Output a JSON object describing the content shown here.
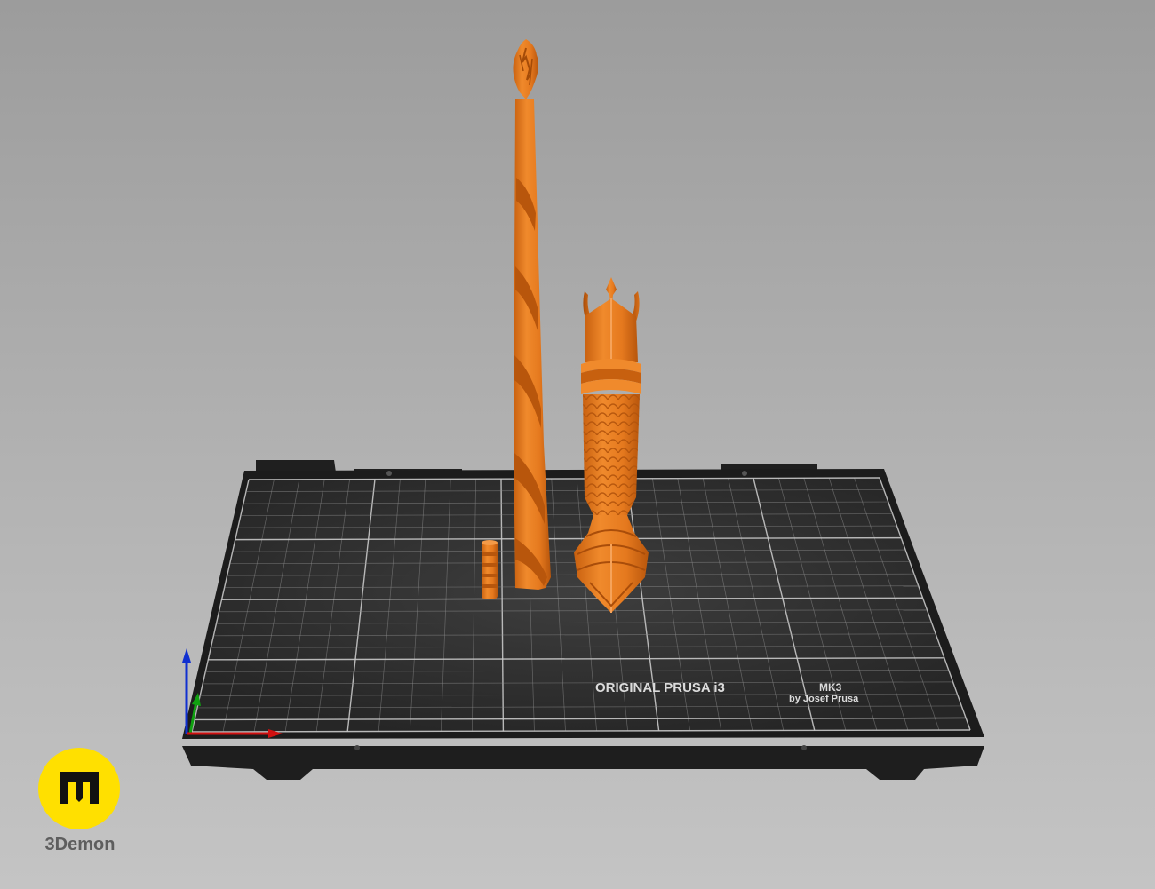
{
  "bed": {
    "title": "ORIGINAL PRUSA i3",
    "model_suffix": "MK3",
    "byline": "by Josef Prusa",
    "surface_color": "#2b2b2b",
    "grid_color": "#8a8a8a",
    "frame_color": "#1c1c1c"
  },
  "objects": [
    {
      "name": "staff-shaft",
      "color": "#e5791e"
    },
    {
      "name": "staff-head",
      "color": "#e5791e"
    },
    {
      "name": "small-connector",
      "color": "#e5791e"
    }
  ],
  "axes": {
    "x_color": "#d01010",
    "y_color": "#10a010",
    "z_color": "#1030d0"
  },
  "brand": {
    "name": "3Demon",
    "logo_color": "#ffe000"
  }
}
